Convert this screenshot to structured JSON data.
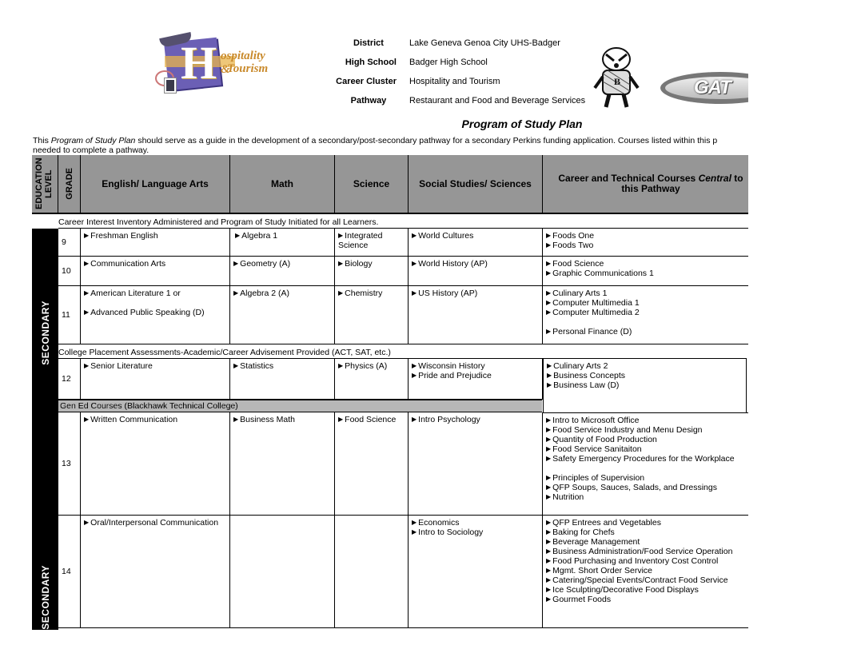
{
  "header": {
    "logo_left": {
      "name": "hospitality-tourism-logo",
      "line1": "ospitality &",
      "line2": "Tourism",
      "letter": "H"
    },
    "fields": [
      {
        "label": "District",
        "value": "Lake Geneva Genoa City UHS-Badger"
      },
      {
        "label": "High School",
        "value": "Badger High School"
      },
      {
        "label": "Career Cluster",
        "value": "Hospitality and Tourism"
      },
      {
        "label": "Pathway",
        "value": "Restaurant and Food and Beverage Services"
      }
    ],
    "logo_gateway_text": "GAT"
  },
  "title": "Program of Study Plan",
  "intro": {
    "prefix": "This ",
    "italic": "Program of Study Plan",
    "rest": " should serve as a guide in the development of a secondary/post-secondary pathway for a secondary Perkins funding application.  Courses listed within this p",
    "line2": "needed to complete a pathway."
  },
  "table": {
    "headers": {
      "education_level": "EDUCATION LEVEL",
      "grade": "GRADE",
      "english": "English/ Language Arts",
      "math": "Math",
      "science": "Science",
      "social": "Social Studies/ Sciences",
      "career_prefix": "Career and Technical Courses ",
      "career_italic": "Central",
      "career_suffix": " to this Pathway"
    },
    "band_career_interest": "Career Interest Inventory Administered and Program of Study Initiated for all Learners.",
    "band_college_placement": "College Placement Assessments-Academic/Career Advisement Provided (ACT, SAT, etc.)",
    "band_gened": "Gen Ed Courses (Blackhawk Technical College)",
    "education_level_labels": [
      "SECONDARY",
      "SECONDARY"
    ],
    "rows": [
      {
        "grade": "9",
        "english": [
          "Freshman English"
        ],
        "math": [
          "Algebra 1"
        ],
        "science": [
          "Integrated Science"
        ],
        "social": [
          "World Cultures"
        ],
        "career": [
          "Foods One",
          "Foods Two"
        ]
      },
      {
        "grade": "10",
        "english": [
          "Communication Arts"
        ],
        "math": [
          "Geometry (A)"
        ],
        "science": [
          "Biology"
        ],
        "social": [
          "World History (AP)"
        ],
        "career": [
          "Food Science",
          "Graphic Communications 1"
        ]
      },
      {
        "grade": "11",
        "english": [
          "American Literature 1 or",
          "Advanced Public Speaking (D)"
        ],
        "math": [
          "Algebra 2 (A)"
        ],
        "science": [
          "Chemistry"
        ],
        "social": [
          "US History (AP)"
        ],
        "career": [
          "Culinary Arts 1",
          "Computer Multimedia 1",
          "Computer Multimedia 2",
          "Personal Finance (D)"
        ]
      },
      {
        "grade": "12",
        "english": [
          "Senior Literature"
        ],
        "math": [
          "Statistics"
        ],
        "science": [
          "Physics (A)"
        ],
        "social": [
          "Wisconsin History",
          "Pride and Prejudice"
        ],
        "career": [
          "Culinary Arts 2",
          "Business Concepts",
          "Business Law (D)"
        ]
      },
      {
        "grade": "13",
        "english": [
          "Written Communication"
        ],
        "math": [
          "Business Math"
        ],
        "science": [
          "Food Science"
        ],
        "social": [
          "Intro Psychology"
        ],
        "career": [
          "Intro to Microsoft Office",
          "Food Service Industry and Menu Design",
          "Quantity of Food Production",
          "Food Service Sanitaiton",
          "Safety Emergency Procedures for the Workplace",
          "Principles of Supervision",
          "QFP Soups, Sauces, Salads, and Dressings",
          "Nutrition"
        ]
      },
      {
        "grade": "14",
        "english": [
          "Oral/Interpersonal Communication"
        ],
        "math": [],
        "science": [],
        "social": [
          "Economics",
          "Intro to Sociology"
        ],
        "career": [
          "QFP Entrees and Vegetables",
          "Baking for Chefs",
          "Beverage Management",
          "Business Administration/Food Service Operation",
          "Food Purchasing and Inventory Cost Control",
          "Mgmt. Short Order Service",
          "Catering/Special Events/Contract Food Service",
          "Ice Sculpting/Decorative Food Displays",
          "Gourmet Foods"
        ]
      }
    ]
  }
}
